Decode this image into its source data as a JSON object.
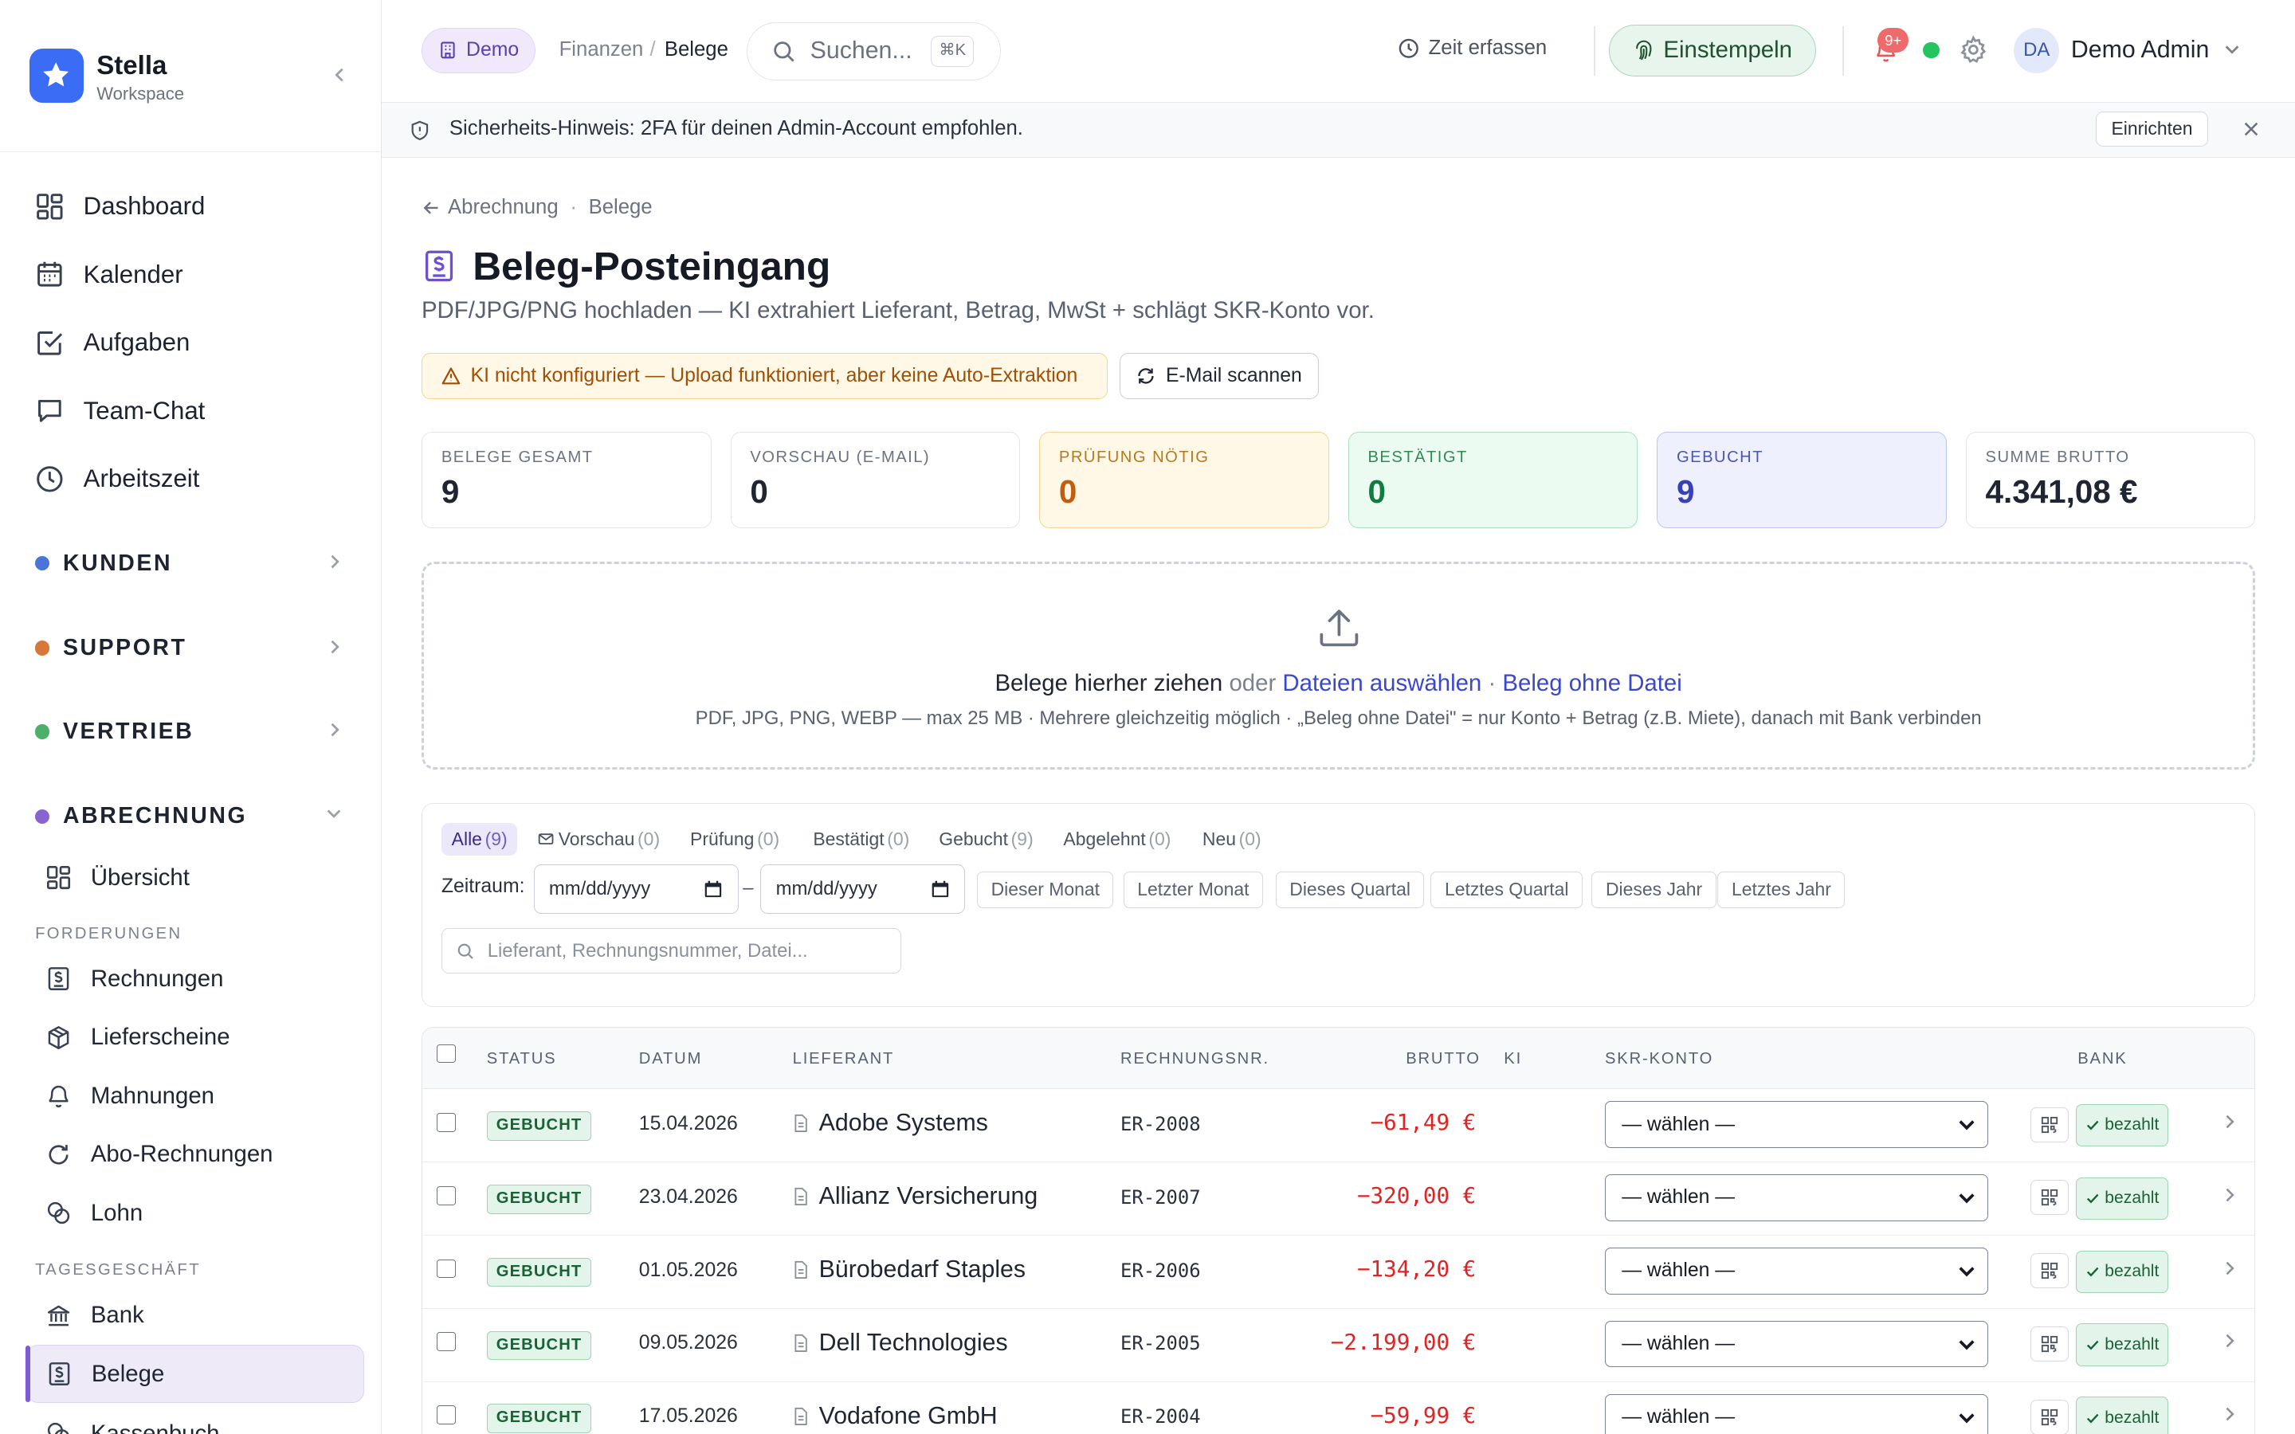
{
  "brand": {
    "name": "Stella",
    "sub": "Workspace"
  },
  "nav_main": [
    {
      "label": "Dashboard",
      "icon": "dashboard-icon"
    },
    {
      "label": "Kalender",
      "icon": "calendar-icon"
    },
    {
      "label": "Aufgaben",
      "icon": "task-check-icon"
    },
    {
      "label": "Team-Chat",
      "icon": "chat-icon"
    },
    {
      "label": "Arbeitszeit",
      "icon": "clock-icon"
    }
  ],
  "groups": {
    "kunden": {
      "label": "KUNDEN",
      "color": "#4a74d8"
    },
    "support": {
      "label": "SUPPORT",
      "color": "#d8773a"
    },
    "vertrieb": {
      "label": "VERTRIEB",
      "color": "#4caf6a"
    },
    "abrechnung": {
      "label": "ABRECHNUNG",
      "color": "#8a63d2"
    }
  },
  "abrechnung_nav": {
    "uebersicht": "Übersicht",
    "section_forderungen": "FORDERUNGEN",
    "rechnungen": "Rechnungen",
    "lieferscheine": "Lieferscheine",
    "mahnungen": "Mahnungen",
    "abo_rechnungen": "Abo-Rechnungen",
    "lohn": "Lohn",
    "section_tagesgeschaeft": "TAGESGESCHÄFT",
    "bank": "Bank",
    "belege": "Belege",
    "kassenbuch": "Kassenbuch"
  },
  "topbar": {
    "demo": "Demo",
    "breadcrumb_parent": "Finanzen",
    "breadcrumb_sep": "/",
    "breadcrumb_current": "Belege",
    "search_placeholder": "Suchen...",
    "search_kbd": "⌘K",
    "zeit": "Zeit erfassen",
    "stamp": "Einstempeln",
    "notif_count": "9+",
    "avatar_initials": "DA",
    "user_name": "Demo Admin"
  },
  "notice": {
    "text": "Sicherheits-Hinweis: 2FA für deinen Admin-Account empfohlen.",
    "button": "Einrichten"
  },
  "page": {
    "crumb_back": "Abrechnung",
    "crumb_sep": "·",
    "crumb_current": "Belege",
    "title": "Beleg-Posteingang",
    "subtitle": "PDF/JPG/PNG hochladen — KI extrahiert Lieferant, Betrag, MwSt + schlägt SKR-Konto vor.",
    "warning": "KI nicht konfiguriert — Upload funktioniert, aber keine Auto-Extraktion",
    "email_scan": "E-Mail scannen"
  },
  "stats": [
    {
      "label": "BELEGE GESAMT",
      "value": "9",
      "bg": "#ffffff",
      "border": "#e2e5ea",
      "lc": "#6b7280",
      "vc": "#1f2533"
    },
    {
      "label": "VORSCHAU (E-MAIL)",
      "value": "0",
      "bg": "#ffffff",
      "border": "#e2e5ea",
      "lc": "#6b7280",
      "vc": "#1f2533"
    },
    {
      "label": "PRÜFUNG NÖTIG",
      "value": "0",
      "bg": "#fff8e6",
      "border": "#f3d58d",
      "lc": "#b7791f",
      "vc": "#c25e0c"
    },
    {
      "label": "BESTÄTIGT",
      "value": "0",
      "bg": "#ecfbf2",
      "border": "#a9e1bf",
      "lc": "#2f8a55",
      "vc": "#137a42"
    },
    {
      "label": "GEBUCHT",
      "value": "9",
      "bg": "#eef0fd",
      "border": "#bcc5f3",
      "lc": "#4a55b8",
      "vc": "#3940b6"
    },
    {
      "label": "SUMME BRUTTO",
      "value": "4.341,08 €",
      "bg": "#ffffff",
      "border": "#e2e5ea",
      "lc": "#6b7280",
      "vc": "#1f2533"
    }
  ],
  "dropzone": {
    "drag": "Belege hierher ziehen",
    "or": "oder",
    "choose": "Dateien auswählen",
    "dot": "·",
    "nofile": "Beleg ohne Datei",
    "hint": "PDF, JPG, PNG, WEBP — max 25 MB · Mehrere gleichzeitig möglich · „Beleg ohne Datei\" = nur Konto + Betrag (z.B. Miete), danach mit Bank verbinden"
  },
  "filter_tabs": [
    {
      "label": "Alle",
      "count": "(9)"
    },
    {
      "label": "Vorschau",
      "count": "(0)"
    },
    {
      "label": "Prüfung",
      "count": "(0)"
    },
    {
      "label": "Bestätigt",
      "count": "(0)"
    },
    {
      "label": "Gebucht",
      "count": "(9)"
    },
    {
      "label": "Abgelehnt",
      "count": "(0)"
    },
    {
      "label": "Neu",
      "count": "(0)"
    }
  ],
  "zeitraum": {
    "label": "Zeitraum:",
    "from": "mm/dd/yyyy",
    "to": "mm/dd/yyyy",
    "dash": "–",
    "quick": [
      "Dieser Monat",
      "Letzter Monat",
      "Dieses Quartal",
      "Letztes Quartal",
      "Dieses Jahr",
      "Letztes Jahr"
    ]
  },
  "table_search_placeholder": "Lieferant, Rechnungsnummer, Datei...",
  "table": {
    "headers": {
      "status": "STATUS",
      "datum": "DATUM",
      "lieferant": "LIEFERANT",
      "rechnungsnr": "RECHNUNGSNR.",
      "brutto": "BRUTTO",
      "ki": "KI",
      "skr": "SKR-KONTO",
      "bank": "BANK"
    },
    "rows": [
      {
        "status": "GEBUCHT",
        "datum": "15.04.2026",
        "lieferant": "Adobe Systems",
        "nr": "ER-2008",
        "brutto": "−61,49 €",
        "skr": "— wählen —",
        "bank": "bezahlt"
      },
      {
        "status": "GEBUCHT",
        "datum": "23.04.2026",
        "lieferant": "Allianz Versicherung",
        "nr": "ER-2007",
        "brutto": "−320,00 €",
        "skr": "— wählen —",
        "bank": "bezahlt"
      },
      {
        "status": "GEBUCHT",
        "datum": "01.05.2026",
        "lieferant": "Bürobedarf Staples",
        "nr": "ER-2006",
        "brutto": "−134,20 €",
        "skr": "— wählen —",
        "bank": "bezahlt"
      },
      {
        "status": "GEBUCHT",
        "datum": "09.05.2026",
        "lieferant": "Dell Technologies",
        "nr": "ER-2005",
        "brutto": "−2.199,00 €",
        "skr": "— wählen —",
        "bank": "bezahlt"
      },
      {
        "status": "GEBUCHT",
        "datum": "17.05.2026",
        "lieferant": "Vodafone GmbH",
        "nr": "ER-2004",
        "brutto": "−59,99 €",
        "skr": "— wählen —",
        "bank": "bezahlt"
      }
    ]
  }
}
